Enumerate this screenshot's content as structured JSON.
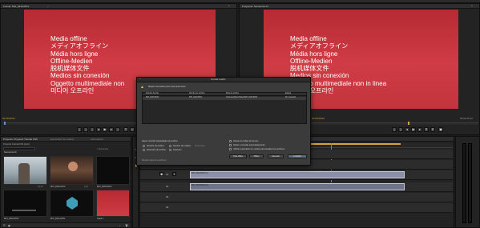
{
  "source_monitor": {
    "title": "Fuente: MVI_0216.MOV",
    "offline_lines": [
      "Media offline",
      "メディアオフライン",
      "Média hors ligne",
      "Offline-Medien",
      "脱机媒体文件",
      "Medios sin conexión",
      "Oggetto multimediale non",
      "미디어 오프라인"
    ],
    "timecode_in": "00;00;00;01",
    "timecode_duration": "00;00;03;16"
  },
  "program_monitor": {
    "title": "Programa: Secuencia 01",
    "offline_lines": [
      "Media offline",
      "メディアオフライン",
      "Média hors ligne",
      "Offline-Medien",
      "脱机媒体文件",
      "Medios sin conexión",
      "Oggetto multimediale non in linea",
      "미디어 오프라인"
    ],
    "timecode_in": "00;00;00;00",
    "timecode_duration": "00;00;15;13"
  },
  "project_panel": {
    "tabs": [
      "Proyecto: Proyecto Tutorial CS6",
      "Explorador de medios",
      "Información"
    ],
    "bin_path": "Proyecto Tutorial CS6.prproj",
    "item_count": "7 elementos",
    "thumbnails": [
      {
        "label": "Secuencia 01",
        "dur": "15;13"
      },
      {
        "label": "MVI_0216.MOV",
        "dur": "3;16"
      },
      {
        "label": "MVI_0215.MOV",
        "dur": "4;22"
      },
      {
        "label": "MVI_0210.MOV",
        "dur": "6;10"
      },
      {
        "label": "MVI_0211.MOV",
        "dur": "2;05"
      },
      {
        "label": "Capa 1",
        "dur": "5;00"
      },
      {
        "label": "Título 01",
        "dur": "5;00"
      }
    ]
  },
  "timeline": {
    "title": "Secuencia 01",
    "timecode": "00;00;00;00",
    "tracks": [
      "V3",
      "V2",
      "V1",
      "A1",
      "A2",
      "A3"
    ],
    "clips": [
      {
        "label": "MVI_0216.MOV [V]",
        "track": "V1"
      },
      {
        "label": "MVI_0216.MOV [A]",
        "track": "A1"
      }
    ]
  },
  "link_dialog": {
    "title": "Vincular medios",
    "message": "Medios necesarios para este documento",
    "columns": [
      "Nombre del clip",
      "Nombre de archivo",
      "Ruta de archivo",
      "Estado"
    ],
    "row": [
      "MVI_0216.MOV",
      "MVI_0216.MOV",
      "/Volumes/Disco/Video/MVI_0216.MOV",
      "Sin conexión"
    ],
    "match_label": "Hacer coincidir propiedades de archivo",
    "opt_name": "Nombre de archivo",
    "opt_ext": "Extensión de archivo",
    "opt_media": "Nombre de medios",
    "opt_id": "ID de cinta",
    "opt_duration": "Duración",
    "check_align": "Alinear el código de tiempo",
    "check_relink": "Volver a vincular automáticamente",
    "check_preserve": "Utilizar explorador de medios para localizar los archivos",
    "btn_offline_all": "Todo offline",
    "btn_offline": "Offline",
    "btn_cancel": "Cancelar",
    "btn_locate": "Localizar",
    "footer": "Mostrar todos los archivos"
  }
}
